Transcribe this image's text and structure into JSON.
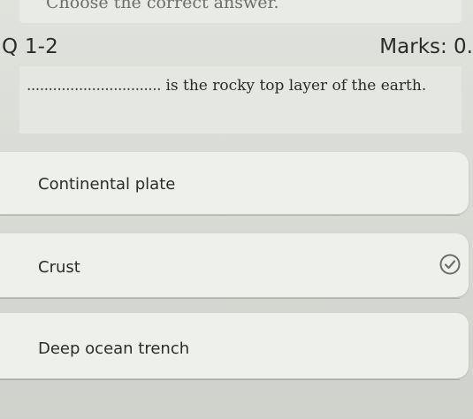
{
  "header": {
    "previous_instruction": "Choose the correct answer.",
    "question_number": "Q 1-2",
    "marks": "Marks: 0."
  },
  "question": {
    "blank": "...............................",
    "text": "is the rocky top layer of the earth."
  },
  "options": [
    {
      "label": "Continental plate",
      "selected": false
    },
    {
      "label": "Crust",
      "selected": true
    },
    {
      "label": "Deep ocean trench",
      "selected": false
    }
  ],
  "icons": {
    "selected_check": "check-circle-icon"
  },
  "colors": {
    "background": "#d9dbd6",
    "card": "#eef0eb",
    "question_box": "#e5e7e2"
  }
}
